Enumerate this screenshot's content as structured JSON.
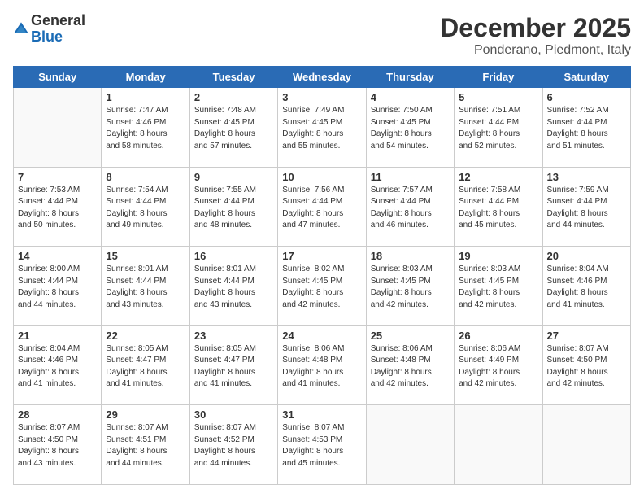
{
  "header": {
    "logo_general": "General",
    "logo_blue": "Blue",
    "title": "December 2025",
    "subtitle": "Ponderano, Piedmont, Italy"
  },
  "weekdays": [
    "Sunday",
    "Monday",
    "Tuesday",
    "Wednesday",
    "Thursday",
    "Friday",
    "Saturday"
  ],
  "weeks": [
    [
      {
        "day": "",
        "info": ""
      },
      {
        "day": "1",
        "info": "Sunrise: 7:47 AM\nSunset: 4:46 PM\nDaylight: 8 hours\nand 58 minutes."
      },
      {
        "day": "2",
        "info": "Sunrise: 7:48 AM\nSunset: 4:45 PM\nDaylight: 8 hours\nand 57 minutes."
      },
      {
        "day": "3",
        "info": "Sunrise: 7:49 AM\nSunset: 4:45 PM\nDaylight: 8 hours\nand 55 minutes."
      },
      {
        "day": "4",
        "info": "Sunrise: 7:50 AM\nSunset: 4:45 PM\nDaylight: 8 hours\nand 54 minutes."
      },
      {
        "day": "5",
        "info": "Sunrise: 7:51 AM\nSunset: 4:44 PM\nDaylight: 8 hours\nand 52 minutes."
      },
      {
        "day": "6",
        "info": "Sunrise: 7:52 AM\nSunset: 4:44 PM\nDaylight: 8 hours\nand 51 minutes."
      }
    ],
    [
      {
        "day": "7",
        "info": "Sunrise: 7:53 AM\nSunset: 4:44 PM\nDaylight: 8 hours\nand 50 minutes."
      },
      {
        "day": "8",
        "info": "Sunrise: 7:54 AM\nSunset: 4:44 PM\nDaylight: 8 hours\nand 49 minutes."
      },
      {
        "day": "9",
        "info": "Sunrise: 7:55 AM\nSunset: 4:44 PM\nDaylight: 8 hours\nand 48 minutes."
      },
      {
        "day": "10",
        "info": "Sunrise: 7:56 AM\nSunset: 4:44 PM\nDaylight: 8 hours\nand 47 minutes."
      },
      {
        "day": "11",
        "info": "Sunrise: 7:57 AM\nSunset: 4:44 PM\nDaylight: 8 hours\nand 46 minutes."
      },
      {
        "day": "12",
        "info": "Sunrise: 7:58 AM\nSunset: 4:44 PM\nDaylight: 8 hours\nand 45 minutes."
      },
      {
        "day": "13",
        "info": "Sunrise: 7:59 AM\nSunset: 4:44 PM\nDaylight: 8 hours\nand 44 minutes."
      }
    ],
    [
      {
        "day": "14",
        "info": "Sunrise: 8:00 AM\nSunset: 4:44 PM\nDaylight: 8 hours\nand 44 minutes."
      },
      {
        "day": "15",
        "info": "Sunrise: 8:01 AM\nSunset: 4:44 PM\nDaylight: 8 hours\nand 43 minutes."
      },
      {
        "day": "16",
        "info": "Sunrise: 8:01 AM\nSunset: 4:44 PM\nDaylight: 8 hours\nand 43 minutes."
      },
      {
        "day": "17",
        "info": "Sunrise: 8:02 AM\nSunset: 4:45 PM\nDaylight: 8 hours\nand 42 minutes."
      },
      {
        "day": "18",
        "info": "Sunrise: 8:03 AM\nSunset: 4:45 PM\nDaylight: 8 hours\nand 42 minutes."
      },
      {
        "day": "19",
        "info": "Sunrise: 8:03 AM\nSunset: 4:45 PM\nDaylight: 8 hours\nand 42 minutes."
      },
      {
        "day": "20",
        "info": "Sunrise: 8:04 AM\nSunset: 4:46 PM\nDaylight: 8 hours\nand 41 minutes."
      }
    ],
    [
      {
        "day": "21",
        "info": "Sunrise: 8:04 AM\nSunset: 4:46 PM\nDaylight: 8 hours\nand 41 minutes."
      },
      {
        "day": "22",
        "info": "Sunrise: 8:05 AM\nSunset: 4:47 PM\nDaylight: 8 hours\nand 41 minutes."
      },
      {
        "day": "23",
        "info": "Sunrise: 8:05 AM\nSunset: 4:47 PM\nDaylight: 8 hours\nand 41 minutes."
      },
      {
        "day": "24",
        "info": "Sunrise: 8:06 AM\nSunset: 4:48 PM\nDaylight: 8 hours\nand 41 minutes."
      },
      {
        "day": "25",
        "info": "Sunrise: 8:06 AM\nSunset: 4:48 PM\nDaylight: 8 hours\nand 42 minutes."
      },
      {
        "day": "26",
        "info": "Sunrise: 8:06 AM\nSunset: 4:49 PM\nDaylight: 8 hours\nand 42 minutes."
      },
      {
        "day": "27",
        "info": "Sunrise: 8:07 AM\nSunset: 4:50 PM\nDaylight: 8 hours\nand 42 minutes."
      }
    ],
    [
      {
        "day": "28",
        "info": "Sunrise: 8:07 AM\nSunset: 4:50 PM\nDaylight: 8 hours\nand 43 minutes."
      },
      {
        "day": "29",
        "info": "Sunrise: 8:07 AM\nSunset: 4:51 PM\nDaylight: 8 hours\nand 44 minutes."
      },
      {
        "day": "30",
        "info": "Sunrise: 8:07 AM\nSunset: 4:52 PM\nDaylight: 8 hours\nand 44 minutes."
      },
      {
        "day": "31",
        "info": "Sunrise: 8:07 AM\nSunset: 4:53 PM\nDaylight: 8 hours\nand 45 minutes."
      },
      {
        "day": "",
        "info": ""
      },
      {
        "day": "",
        "info": ""
      },
      {
        "day": "",
        "info": ""
      }
    ]
  ]
}
